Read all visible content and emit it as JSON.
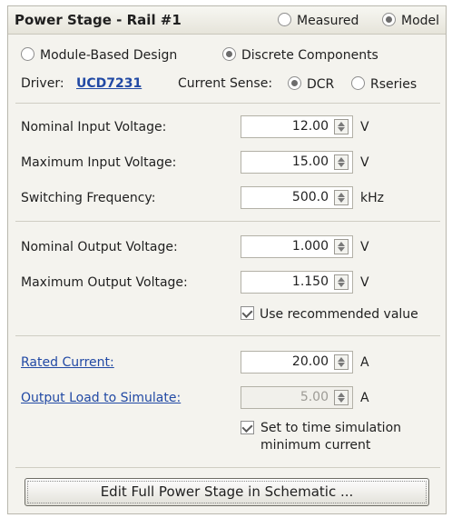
{
  "header": {
    "title": "Power Stage - Rail #1",
    "measured_label": "Measured",
    "model_label": "Model",
    "selected": "Model"
  },
  "design": {
    "module_label": "Module-Based Design",
    "discrete_label": "Discrete Components",
    "selected": "Discrete Components"
  },
  "driver": {
    "label": "Driver:",
    "value": "UCD7231"
  },
  "current_sense": {
    "label": "Current Sense:",
    "dcr_label": "DCR",
    "rseries_label": "Rseries",
    "selected": "DCR"
  },
  "fields": {
    "nominal_input": {
      "label": "Nominal Input Voltage:",
      "value": "12.00",
      "unit": "V"
    },
    "max_input": {
      "label": "Maximum Input Voltage:",
      "value": "15.00",
      "unit": "V"
    },
    "switching_freq": {
      "label": "Switching Frequency:",
      "value": "500.0",
      "unit": "kHz"
    },
    "nominal_output": {
      "label": "Nominal Output Voltage:",
      "value": "1.000",
      "unit": "V"
    },
    "max_output": {
      "label": "Maximum Output Voltage:",
      "value": "1.150",
      "unit": "V"
    },
    "rated_current": {
      "label": "Rated Current:",
      "value": "20.00",
      "unit": "A"
    },
    "output_load": {
      "label": "Output Load to Simulate:",
      "value": "5.00",
      "unit": "A"
    }
  },
  "checkboxes": {
    "use_recommended": {
      "label": "Use recommended value",
      "checked": true
    },
    "min_current": {
      "line1": "Set to time simulation",
      "line2": "minimum current",
      "checked": true
    }
  },
  "button": {
    "label": "Edit Full Power Stage in Schematic ..."
  }
}
